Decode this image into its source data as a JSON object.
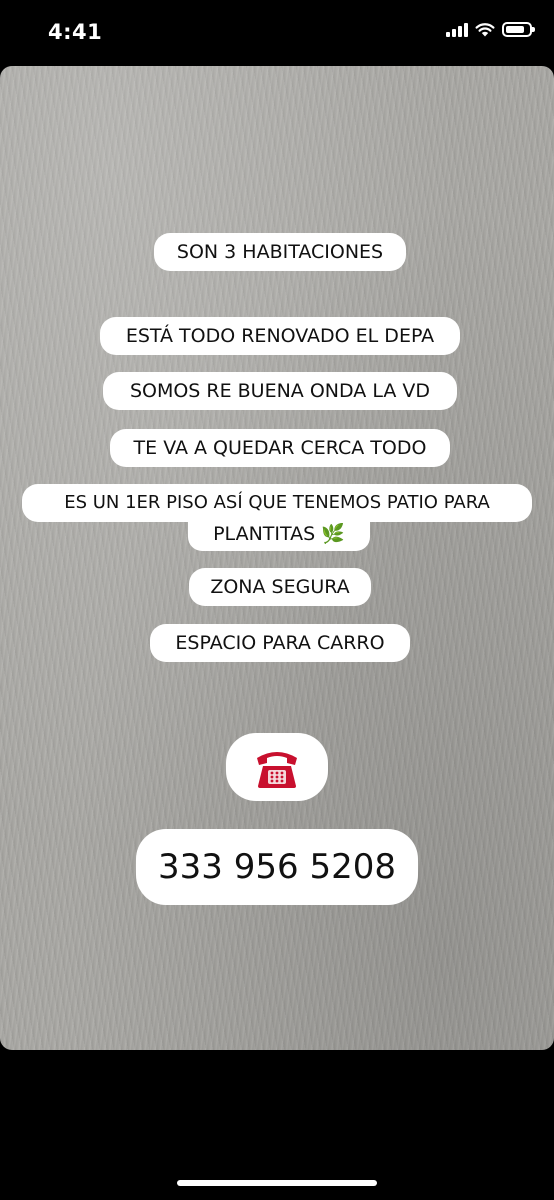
{
  "status_bar": {
    "time": "4:41"
  },
  "story": {
    "lines": [
      "SON 3 HABITACIONES",
      "ESTÁ TODO RENOVADO EL DEPA",
      "SOMOS RE BUENA ONDA LA VD",
      "TE VA A QUEDAR CERCA TODO",
      "ES UN 1ER PISO ASÍ QUE TENEMOS PATIO PARA",
      "PLANTITAS 🌿",
      "ZONA SEGURA",
      "ESPACIO PARA CARRO"
    ],
    "phone_emoji": "☎️",
    "phone_number": "333 956 5208"
  },
  "icons": [
    "signal-icon",
    "wifi-icon",
    "battery-icon",
    "telephone-icon",
    "herb-icon"
  ],
  "colors": {
    "background": "#000000",
    "bubble": "#ffffff",
    "text": "#111111",
    "wall": "#a9a8a4",
    "phone_red": "#c8102e"
  }
}
